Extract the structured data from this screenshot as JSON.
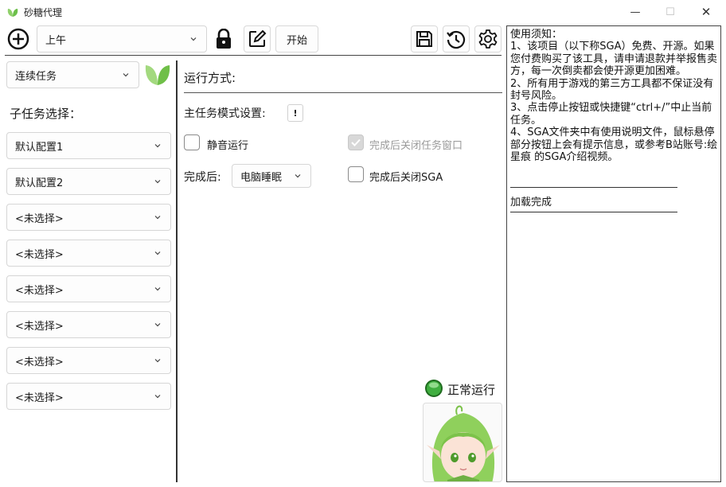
{
  "window": {
    "title": "砂糖代理",
    "minimize_glyph": "—",
    "maximize_glyph": "☐",
    "close_glyph": "✕"
  },
  "toolbar": {
    "add_icon": "plus-circle-icon",
    "time_select": "上午",
    "lock_icon": "lock-icon",
    "edit_icon": "edit-icon",
    "start_label": "开始",
    "save_icon": "save-icon",
    "history_icon": "history-icon",
    "settings_icon": "gear-icon"
  },
  "left": {
    "task_mode": "连续任务",
    "subtask_label": "子任务选择：",
    "configs": [
      "默认配置1",
      "默认配置2",
      "<未选择>",
      "<未选择>",
      "<未选择>",
      "<未选择>",
      "<未选择>",
      "<未选择>"
    ]
  },
  "middle": {
    "run_mode_label": "运行方式:",
    "main_mode_label": "主任务模式设置:",
    "main_mode_info": "!",
    "mute_label": "静音运行",
    "mute_checked": false,
    "close_window_label": "完成后关闭任务窗口",
    "close_window_checked": true,
    "close_window_disabled": true,
    "after_label": "完成后:",
    "after_value": "电脑睡眠",
    "close_sga_label": "完成后关闭SGA",
    "close_sga_checked": false,
    "status_text": "正常运行",
    "status_color": "#2f9e2f"
  },
  "notice": {
    "lines": [
      "使用须知：",
      "1、该项目（以下称SGA）免费、开源。如果您付费购买了该工具，请申请退款并举报售卖方，每一次倒卖都会使开源更加困难。",
      "2、所有用于游戏的第三方工具都不保证没有封号风险。",
      "3、点击停止按钮或快捷键“ctrl+/”中止当前任务。",
      "4、SGA文件夹中有使用说明文件，鼠标悬停部分按钮上会有提示信息，或参考B站账号:绘星痕 的SGA介绍视频。"
    ],
    "status": "加载完成"
  },
  "colors": {
    "accent_green": "#7dc35a",
    "border": "#d6d6d6"
  }
}
